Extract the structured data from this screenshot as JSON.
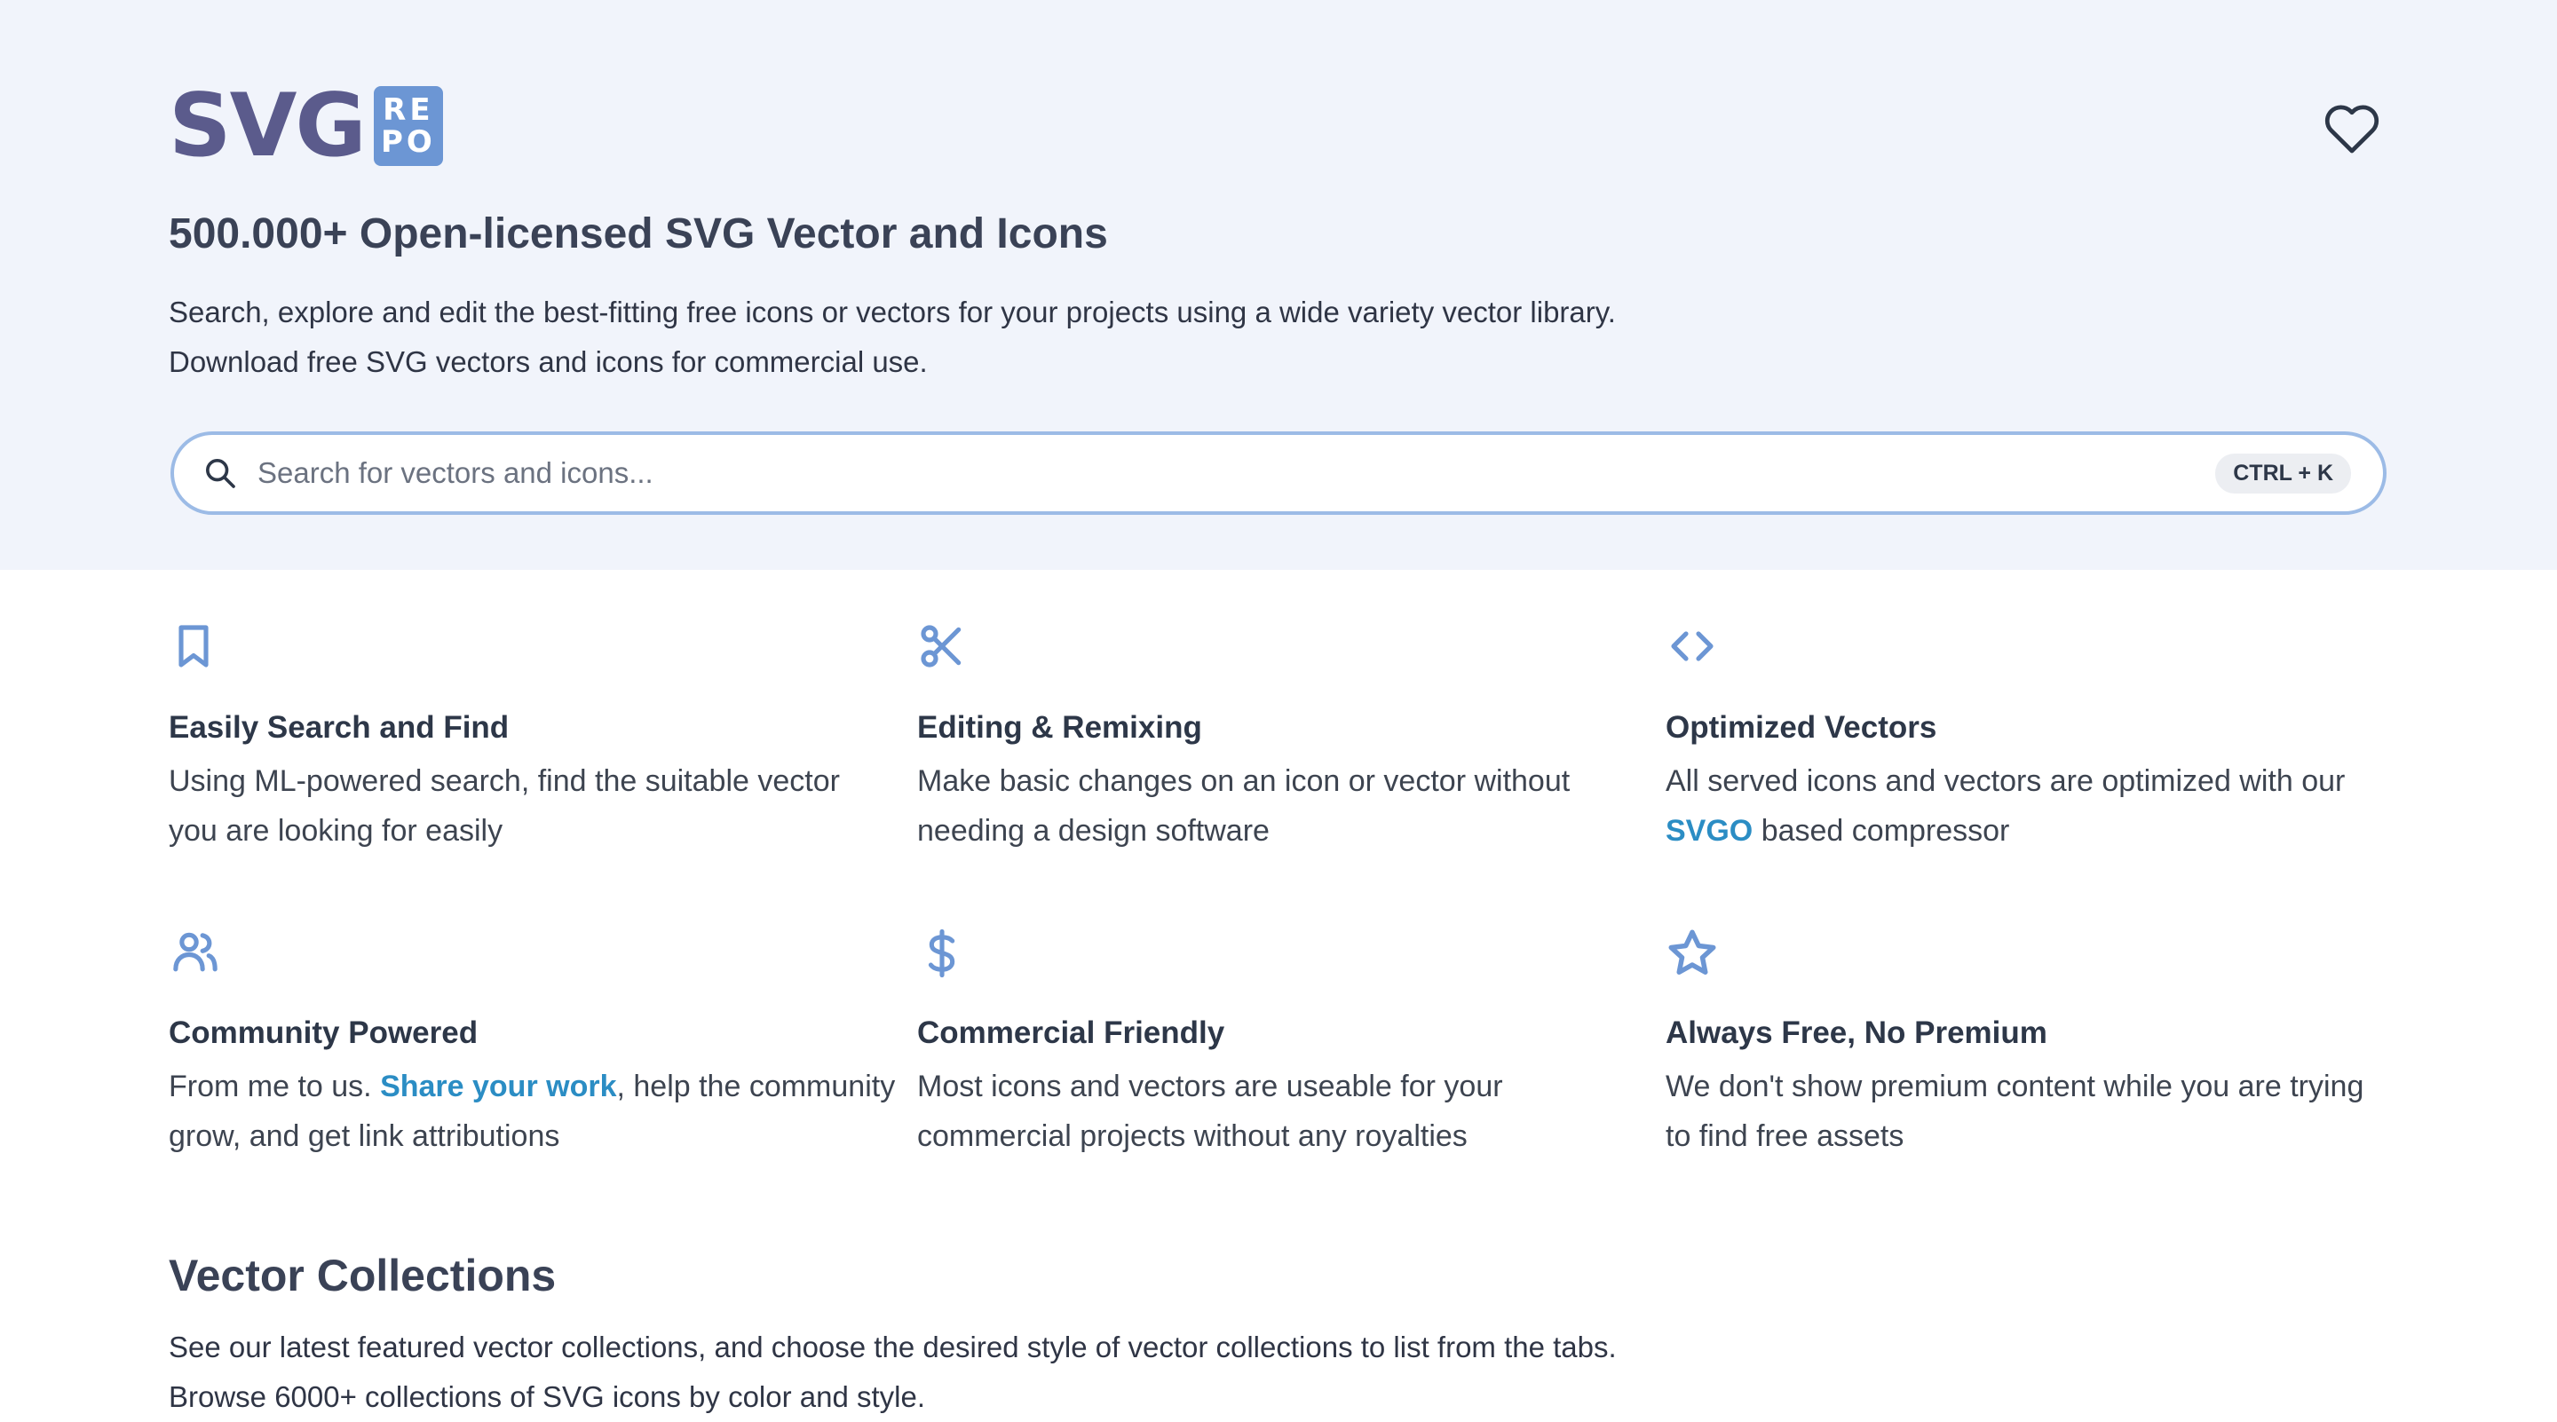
{
  "logo": {
    "text": "SVG",
    "badge_top": "RE",
    "badge_bottom": "PO"
  },
  "header": {
    "favorites_icon": "heart-icon"
  },
  "hero": {
    "title": "500.000+ Open-licensed SVG Vector and Icons",
    "desc_line1": "Search, explore and edit the best-fitting free icons or vectors for your projects using a wide variety vector library.",
    "desc_line2": "Download free SVG vectors and icons for commercial use."
  },
  "search": {
    "placeholder": "Search for vectors and icons...",
    "value": "",
    "shortcut": "CTRL + K",
    "icon": "search-icon"
  },
  "features": [
    {
      "icon": "bookmark-icon",
      "title": "Easily Search and Find",
      "line1": "Using ML-powered search, find the suitable vector",
      "line2": "you are looking for easily"
    },
    {
      "icon": "scissors-icon",
      "title": "Editing & Remixing",
      "line1": "Make basic changes on an icon or vector without",
      "line2": "needing a design software"
    },
    {
      "icon": "code-icon",
      "title": "Optimized Vectors",
      "line1": "All served icons and vectors are optimized with our",
      "line2_link": "SVGO",
      "line2_rest": " based compressor"
    },
    {
      "icon": "users-icon",
      "title": "Community Powered",
      "line1_pre": "From me to us. ",
      "line1_link": "Share your work",
      "line1_post": ", help the community",
      "line2": "grow, and get link attributions"
    },
    {
      "icon": "dollar-icon",
      "title": "Commercial Friendly",
      "line1": "Most icons and vectors are useable for your",
      "line2": "commercial projects without any royalties"
    },
    {
      "icon": "star-icon",
      "title": "Always Free, No Premium",
      "line1": "We don't show premium content while you are trying",
      "line2": "to find free assets"
    }
  ],
  "collections": {
    "title": "Vector Collections",
    "desc_line1": "See our latest featured vector collections, and choose the desired style of vector collections to list from the tabs.",
    "desc_line2": "Browse 6000+ collections of SVG icons by color and style."
  },
  "colors": {
    "hero_bg": "#f1f4fb",
    "accent": "#6c96d4",
    "link": "#2b8dc4",
    "logo_text": "#5b5b8c"
  }
}
